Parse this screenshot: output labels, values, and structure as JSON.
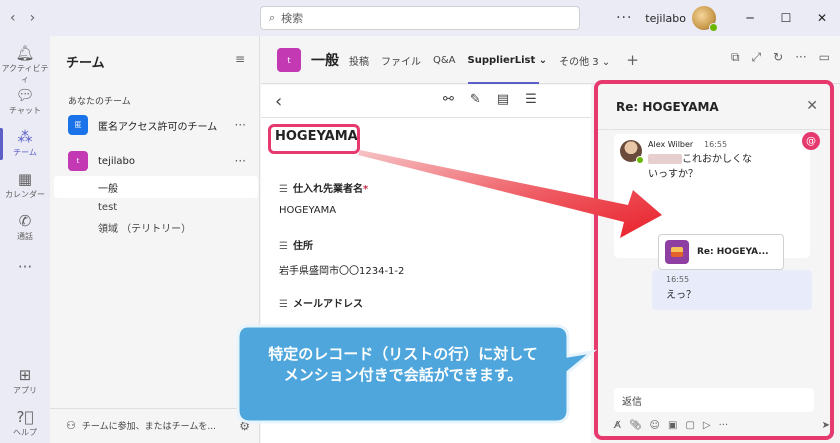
{
  "titlebar": {
    "search_placeholder": "検索",
    "more": "···",
    "user_name": "tejilabo",
    "minimize": "─",
    "maximize": "☐",
    "close": "✕"
  },
  "rail": {
    "items": [
      {
        "label": "アクティビティ",
        "icon": "bell-icon"
      },
      {
        "label": "チャット",
        "icon": "chat-icon"
      },
      {
        "label": "チーム",
        "icon": "teams-icon"
      },
      {
        "label": "カレンダー",
        "icon": "calendar-icon"
      },
      {
        "label": "通話",
        "icon": "phone-icon"
      },
      {
        "label": "···",
        "icon": "more-icon"
      },
      {
        "label": "アプリ",
        "icon": "apps-icon"
      },
      {
        "label": "ヘルプ",
        "icon": "help-icon"
      }
    ]
  },
  "teams": {
    "title": "チーム",
    "section_label": "あなたのチーム",
    "team1": {
      "name": "匿名アクセス許可のチーム",
      "logo": "匿",
      "color": "#1a73e8"
    },
    "team2": {
      "name": "tejilabo",
      "logo": "t",
      "color": "#c239b3"
    },
    "more": "···",
    "channels": [
      "一般",
      "test",
      "領域 （テリトリー）"
    ],
    "footer": "チームに参加、またはチームを..."
  },
  "channel": {
    "logo": "t",
    "name": "一般",
    "tabs": [
      "投稿",
      "ファイル",
      "Q&A",
      "SupplierList ⌄",
      "その他 3 ⌄"
    ],
    "active_tab": "SupplierList ⌄",
    "add": "+"
  },
  "record": {
    "title": "HOGEYAMA",
    "fields": [
      {
        "label": "仕入れ先業者名",
        "required": "*",
        "value": "HOGEYAMA"
      },
      {
        "label": "住所",
        "required": "",
        "value": "岩手県盛岡市〇〇1234-1-2"
      },
      {
        "label": "メールアドレス",
        "required": "",
        "value": ""
      }
    ]
  },
  "conversation": {
    "title": "Re: HOGEYAMA",
    "message": {
      "author": "Alex Wilber",
      "time": "16:55",
      "text": "これおかしくないっすか？",
      "attachment": "Re: HOGEYA..."
    },
    "mention_badge": "@",
    "reply": {
      "time": "16:55",
      "text": "えっ？"
    },
    "reply_placeholder": "返信"
  },
  "callout": {
    "line1": "特定のレコード（リストの行）に対して",
    "line2": "メンション付きで会話ができます。"
  },
  "colors": {
    "accent": "#5b5fc7",
    "highlight": "#e63a6e",
    "arrow": "#e8202a"
  }
}
